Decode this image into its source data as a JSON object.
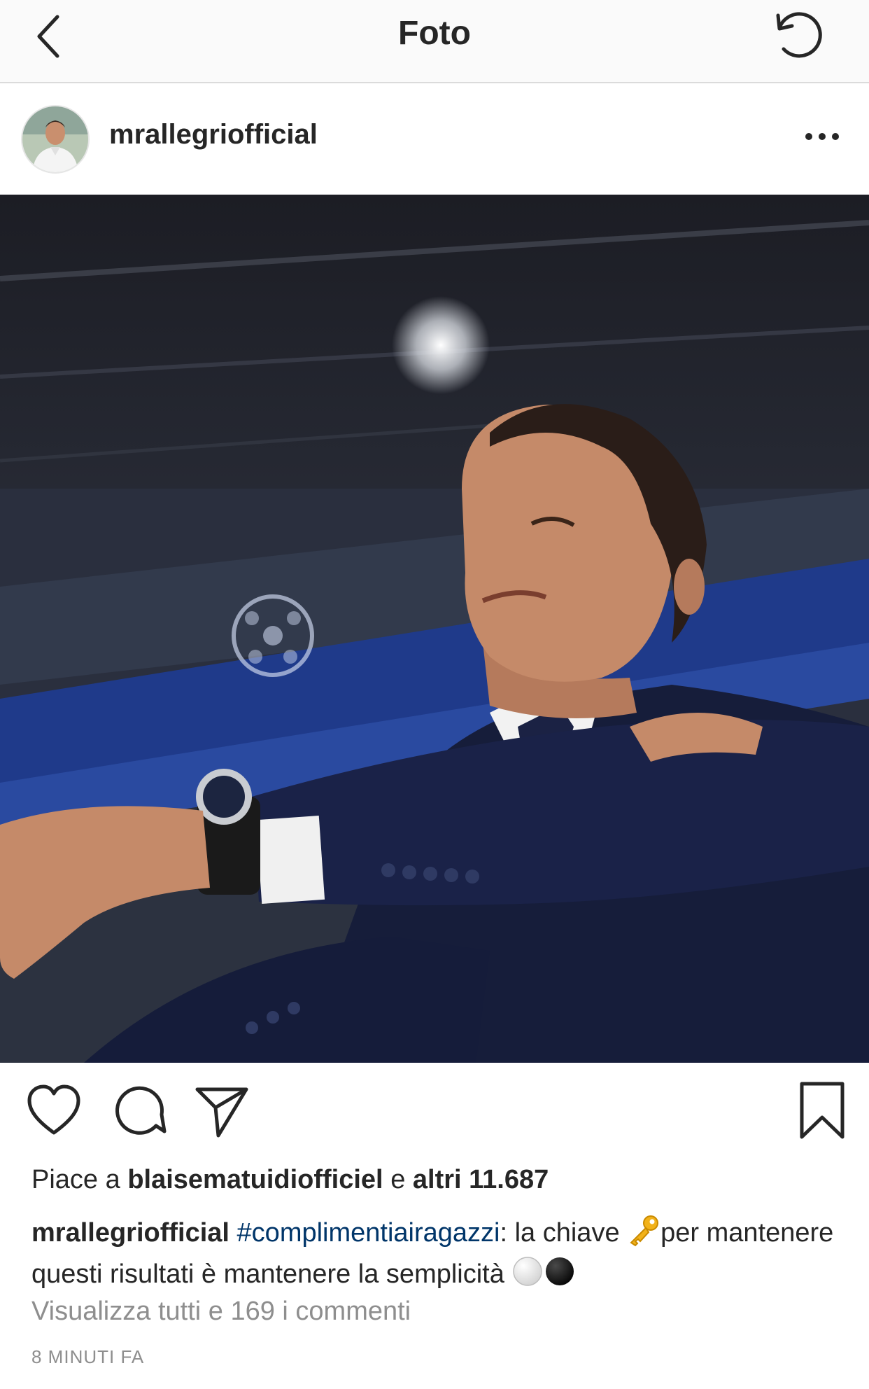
{
  "nav": {
    "title": "Foto",
    "back_icon": "chevron-left-icon",
    "refresh_icon": "refresh-icon"
  },
  "post": {
    "username": "mrallegriofficial",
    "more_icon": "more-dots-icon"
  },
  "actions": {
    "like_icon": "heart-icon",
    "comment_icon": "comment-icon",
    "share_icon": "send-icon",
    "save_icon": "bookmark-icon"
  },
  "likes": {
    "prefix": "Piace a",
    "user": "blaisematuidiofficiel",
    "connector": "e",
    "others": "altri 11.687"
  },
  "caption": {
    "user": "mrallegriofficial",
    "hashtag": "#complimentiairagazzi",
    "text_part1": ": la chiave",
    "text_part2": "per mantenere questi risultati è mantenere la semplicità"
  },
  "comments_link": "Visualizza tutti e 169 i commenti",
  "timestamp": "8 MINUTI FA",
  "colors": {
    "text": "#262626",
    "hashtag": "#003569",
    "muted": "#8e8e8e",
    "topbar_bg": "#fafafa"
  }
}
